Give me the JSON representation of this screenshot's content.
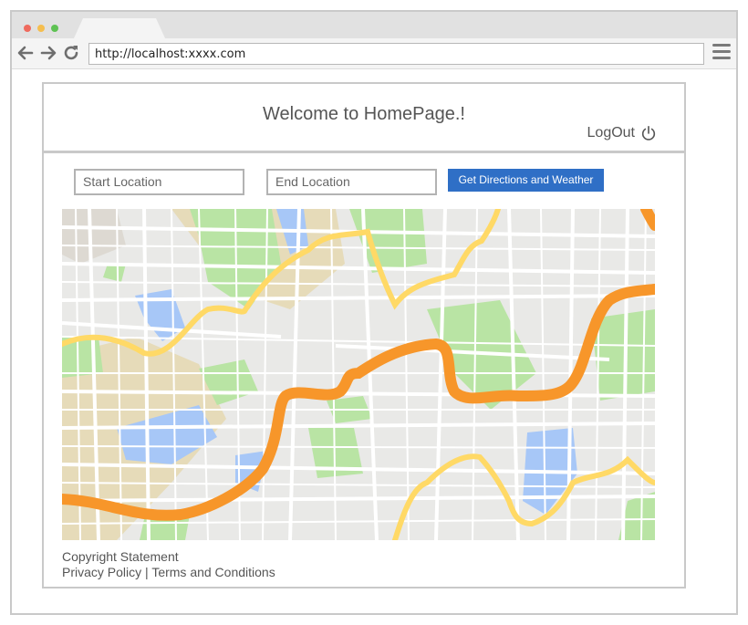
{
  "browser": {
    "url": "http://localhost:xxxx.com"
  },
  "header": {
    "welcome": "Welcome to HomePage.!",
    "logout_label": "LogOut"
  },
  "form": {
    "start_placeholder": "Start Location",
    "end_placeholder": "End Location",
    "button_label": "Get Directions and Weather"
  },
  "footer": {
    "copyright": "Copyright Statement",
    "privacy": "Privacy Policy",
    "separator": "|",
    "terms": "Terms and Conditions"
  },
  "colors": {
    "button_bg": "#2f6fc6",
    "map_road_major": "#f7962a",
    "map_road_minor": "#ffd966",
    "map_park": "#b9e4a4",
    "map_water": "#a7c7f7"
  },
  "icons": {
    "back": "arrow-left-icon",
    "forward": "arrow-right-icon",
    "reload": "reload-icon",
    "menu": "hamburger-menu-icon",
    "power": "power-icon"
  }
}
